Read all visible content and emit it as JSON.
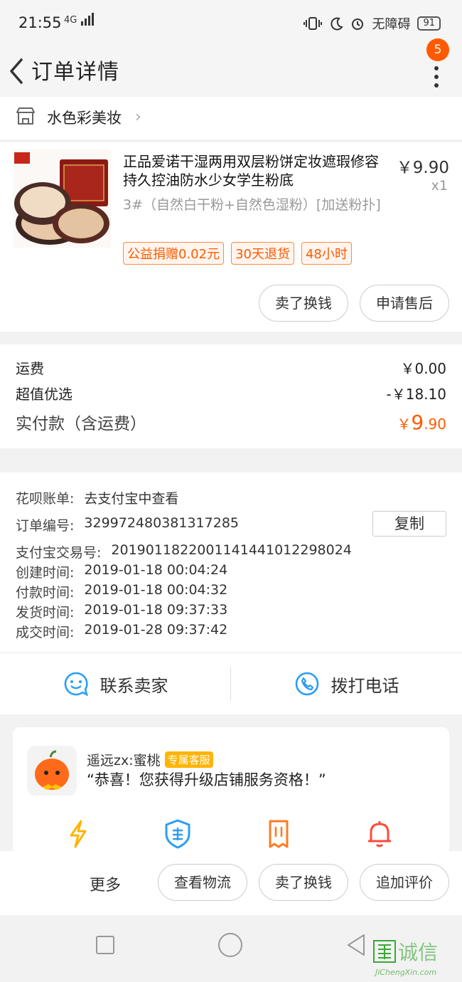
{
  "status_bar": {
    "time": "21:55",
    "signal_label": "4G",
    "accessibility": "无障碍",
    "battery": "91"
  },
  "header": {
    "title": "订单详情",
    "notification_count": "5"
  },
  "shop": {
    "name": "水色彩美妆"
  },
  "product": {
    "title": "正品爱诺干湿两用双层粉饼定妆遮瑕修容持久控油防水少女学生粉底",
    "price": "￥9.90",
    "quantity": "x1",
    "spec": "3#（自然白干粉+自然色湿粉）[加送粉扑]",
    "tags": [
      "公益捐赠0.02元",
      "30天退货",
      "48小时"
    ],
    "actions": [
      "卖了换钱",
      "申请售后"
    ]
  },
  "fees": [
    {
      "label": "运费",
      "value": "￥0.00"
    },
    {
      "label": "超值优选",
      "value": "-￥18.10"
    }
  ],
  "total": {
    "label": "实付款（含运费）",
    "currency": "￥",
    "amount": "9",
    "decimals": ".90"
  },
  "order_info": {
    "huabei_label": "花呗账单:",
    "huabei_value": "去支付宝中查看",
    "order_no_label": "订单编号:",
    "order_no": "329972480381317285",
    "copy_label": "复制",
    "alipay_label": "支付宝交易号:",
    "alipay_no": "2019011822001141441012298024",
    "times": [
      {
        "label": "创建时间:",
        "value": "2019-01-18 00:04:24"
      },
      {
        "label": "付款时间:",
        "value": "2019-01-18 00:04:32"
      },
      {
        "label": "发货时间:",
        "value": "2019-01-18 09:37:33"
      },
      {
        "label": "成交时间:",
        "value": "2019-01-28 09:37:42"
      }
    ]
  },
  "contact": {
    "seller": "联系卖家",
    "phone": "拨打电话"
  },
  "service": {
    "name": "遥远zx:蜜桃",
    "badge": "专属客服",
    "message": "“恭喜！您获得升级店铺服务资格！”",
    "icons": [
      "lightning-icon",
      "after-sale-shield-icon",
      "ticket-icon",
      "bell-icon"
    ]
  },
  "bottom_bar": {
    "more": "更多",
    "actions": [
      "查看物流",
      "卖了换钱",
      "追加评价"
    ]
  },
  "watermark": {
    "text": "诚信",
    "site": "JiChengXin.com"
  },
  "colors": {
    "accent": "#ff5a00",
    "link_blue": "#2b9ef4",
    "badge_yellow": "#ffb400"
  }
}
